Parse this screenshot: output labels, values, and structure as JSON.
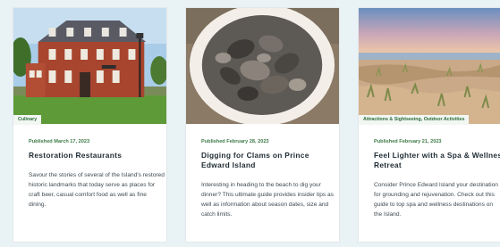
{
  "cards": [
    {
      "tag": "Culinary",
      "published": "Published March 17, 2023",
      "title": "Restoration Restaurants",
      "description": "Savour the stories of several of the Island's restored historic landmarks that today serve as places for craft beer, casual comfort food as well as fine dining."
    },
    {
      "tag": "",
      "published": "Published February 28, 2023",
      "title": "Digging for Clams on Prince Edward Island",
      "description": "Interesting in heading to the beach to dig your dinner? This ultimate guide provides insider tips as well as information about season dates, size and catch limits."
    },
    {
      "tag": "Attractions & Sightseeing, Outdoor Activities",
      "published": "Published February 21, 2023",
      "title": "Feel Lighter with a Spa & Wellness Retreat",
      "description": "Consider Prince Edward Island your destination for grounding and rejuvenation. Check out this guide to top spa and wellness destinations on the Island."
    }
  ]
}
